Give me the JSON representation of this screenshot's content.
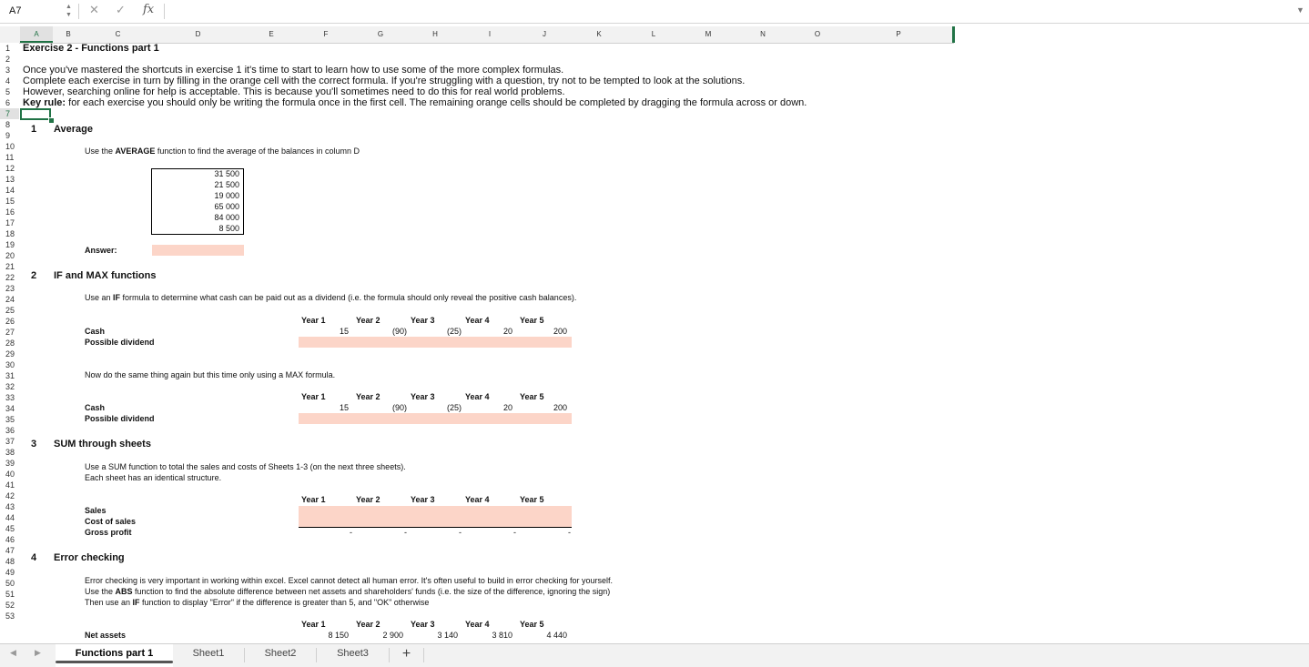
{
  "formula_bar": {
    "name_box": "A7",
    "cancel_glyph": "✕",
    "confirm_glyph": "✓",
    "fx_glyph": "fx",
    "formula": "",
    "updown_glyph": "▲▼",
    "dropdown_glyph": "▼"
  },
  "columns": [
    "A",
    "B",
    "C",
    "D",
    "E",
    "F",
    "G",
    "H",
    "I",
    "J",
    "K",
    "L",
    "M",
    "N",
    "O",
    "P"
  ],
  "rows": [
    "1",
    "2",
    "3",
    "4",
    "5",
    "6",
    "7",
    "8",
    "9",
    "10",
    "11",
    "12",
    "13",
    "14",
    "15",
    "16",
    "17",
    "18",
    "19",
    "20",
    "21",
    "22",
    "23",
    "24",
    "25",
    "26",
    "27",
    "28",
    "29",
    "30",
    "31",
    "32",
    "33",
    "34",
    "35",
    "36",
    "37",
    "38",
    "39",
    "40",
    "41",
    "42",
    "43",
    "44",
    "45",
    "46",
    "47",
    "48",
    "49",
    "50",
    "51",
    "52",
    "53"
  ],
  "selected_row": "7",
  "header": {
    "title": "Exercise 2 - Functions part 1",
    "intro": [
      "Once you've mastered the shortcuts in exercise 1 it's time to start to learn how to use some of the more complex formulas.",
      "Complete each exercise in turn by filling in the orange cell with the correct formula. If you're struggling with a question, try not to be tempted to look at the solutions.",
      "However, searching online for help is acceptable. This is because you'll sometimes need to do this for real world problems."
    ],
    "key_rule_label": "Key rule:",
    "key_rule_text": "for each exercise you should only be writing the formula once in the first cell. The remaining orange cells should be completed by dragging the formula across or down."
  },
  "ex1": {
    "num": "1",
    "title": "Average",
    "instr_pre": "Use the ",
    "instr_bold": "AVERAGE",
    "instr_post": " function to find the average of the balances in column D",
    "balances": [
      "31 500",
      "21 500",
      "19 000",
      "65 000",
      "84 000",
      "8 500"
    ],
    "answer_label": "Answer:"
  },
  "ex2": {
    "num": "2",
    "title": "IF and MAX functions",
    "instr_pre": "Use an ",
    "instr_bold": "IF",
    "instr_post": " formula to determine what cash can be paid out as a dividend (i.e. the formula should only reveal the positive cash balances).",
    "years": [
      "Year 1",
      "Year 2",
      "Year 3",
      "Year 4",
      "Year 5"
    ],
    "cash_label": "Cash",
    "cash": [
      "15",
      "(90)",
      "(25)",
      "20",
      "200"
    ],
    "dividend_label": "Possible dividend",
    "instr2": "Now do the same thing again but this time only using a MAX formula."
  },
  "ex3": {
    "num": "3",
    "title": "SUM through sheets",
    "instr1": "Use a SUM function to total the sales and costs of Sheets 1-3 (on the next three sheets).",
    "instr2": "Each sheet has an identical structure.",
    "years": [
      "Year 1",
      "Year 2",
      "Year 3",
      "Year 4",
      "Year 5"
    ],
    "sales_label": "Sales",
    "cos_label": "Cost of sales",
    "gp_label": "Gross profit",
    "gp_values": [
      "-",
      "-",
      "-",
      "-",
      "-"
    ]
  },
  "ex4": {
    "num": "4",
    "title": "Error checking",
    "instr1": "Error checking is very important in working within excel. Excel cannot detect all human error. It's often useful to build in error checking for yourself.",
    "instr2_pre": "Use the ",
    "instr2_bold": "ABS",
    "instr2_post": " function to find the absolute difference between net assets and shareholders' funds (i.e. the size of the difference, ignoring the sign)",
    "instr3_pre": "Then use an ",
    "instr3_bold": "IF",
    "instr3_post": " function to display \"Error\" if the difference is greater than 5, and \"OK\" otherwise",
    "years": [
      "Year 1",
      "Year 2",
      "Year 3",
      "Year 4",
      "Year 5"
    ],
    "net_assets_label": "Net assets",
    "net_assets": [
      "8 150",
      "2 900",
      "3 140",
      "3 810",
      "4 440"
    ]
  },
  "tabs": {
    "prev": "◀",
    "next": "▶",
    "items": [
      "Functions part 1",
      "Sheet1",
      "Sheet2",
      "Sheet3"
    ],
    "add": "+"
  },
  "colors": {
    "accent": "#217346",
    "input_fill": "#fcd5c8"
  }
}
